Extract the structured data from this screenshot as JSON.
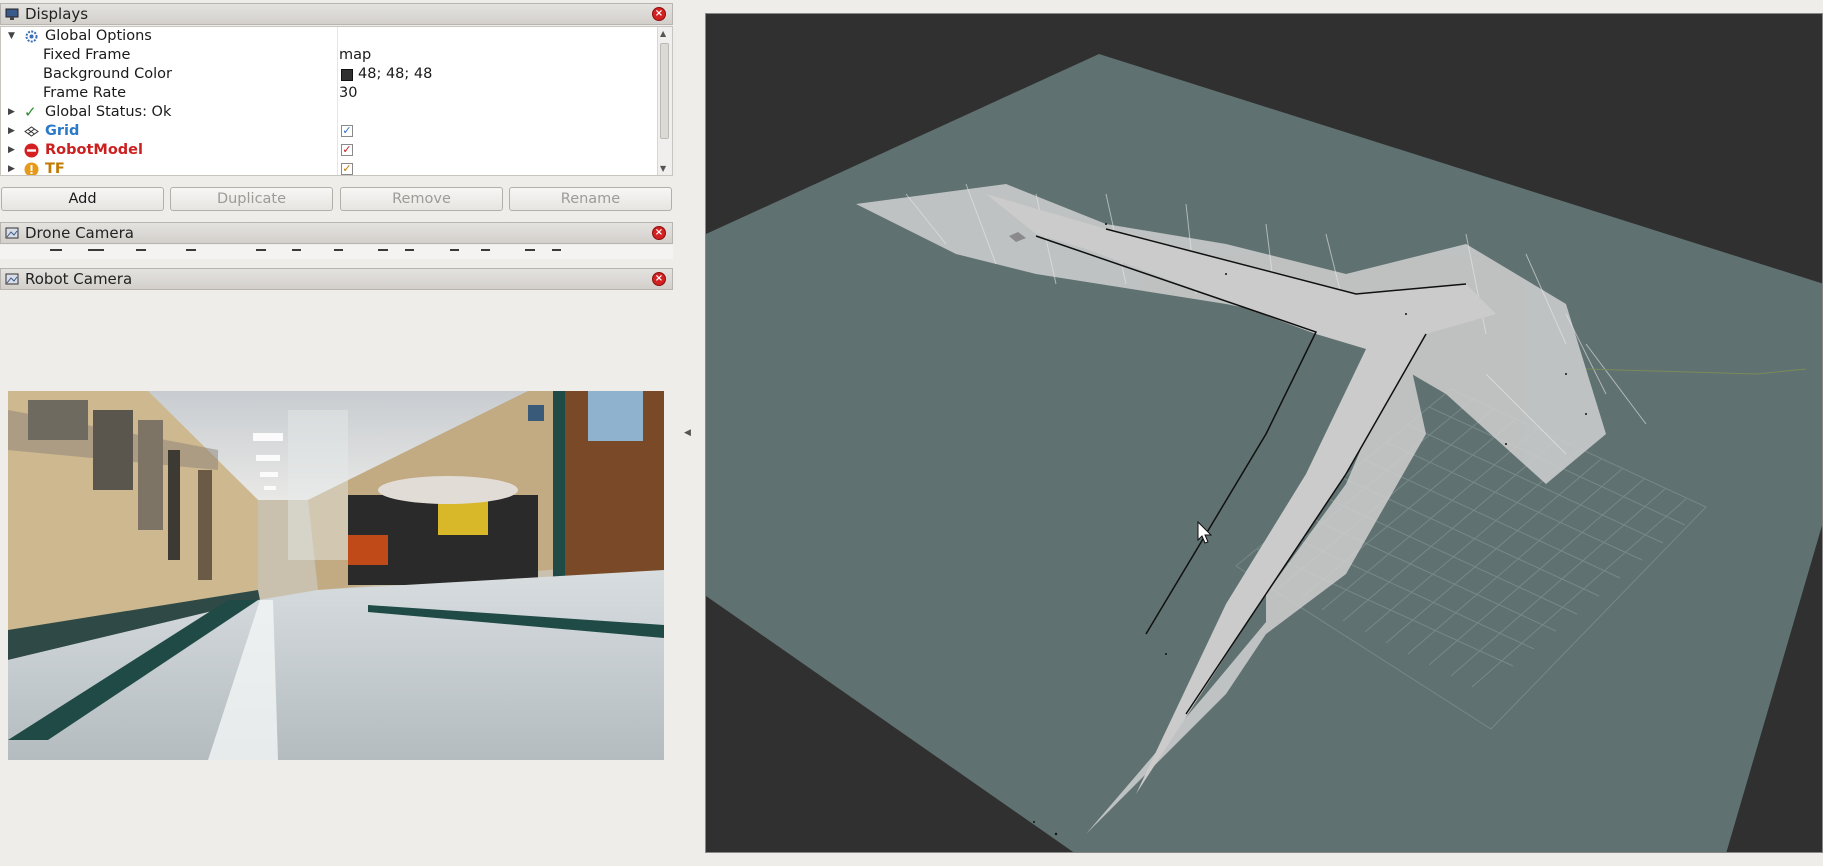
{
  "displays_panel": {
    "title": "Displays",
    "rows": [
      {
        "label": "Global Options",
        "value": ""
      },
      {
        "label": "Fixed Frame",
        "value": "map"
      },
      {
        "label": "Background Color",
        "value": "48; 48; 48"
      },
      {
        "label": "Frame Rate",
        "value": "30"
      },
      {
        "label": "Global Status: Ok",
        "value": ""
      },
      {
        "label": "Grid",
        "value": ""
      },
      {
        "label": "RobotModel",
        "value": ""
      },
      {
        "label": "TF",
        "value": ""
      }
    ],
    "colors": {
      "grid": "#2a7ac8",
      "robotmodel": "#cc2020",
      "tf": "#c07a00",
      "background_swatch": "#303030"
    }
  },
  "buttons": {
    "add": "Add",
    "duplicate": "Duplicate",
    "remove": "Remove",
    "rename": "Rename"
  },
  "drone_camera": {
    "title": "Drone Camera"
  },
  "robot_camera": {
    "title": "Robot Camera"
  },
  "view_3d": {
    "background": "#303030",
    "ground_color": "#5f7170",
    "map_free_color": "#cfcfcf"
  }
}
